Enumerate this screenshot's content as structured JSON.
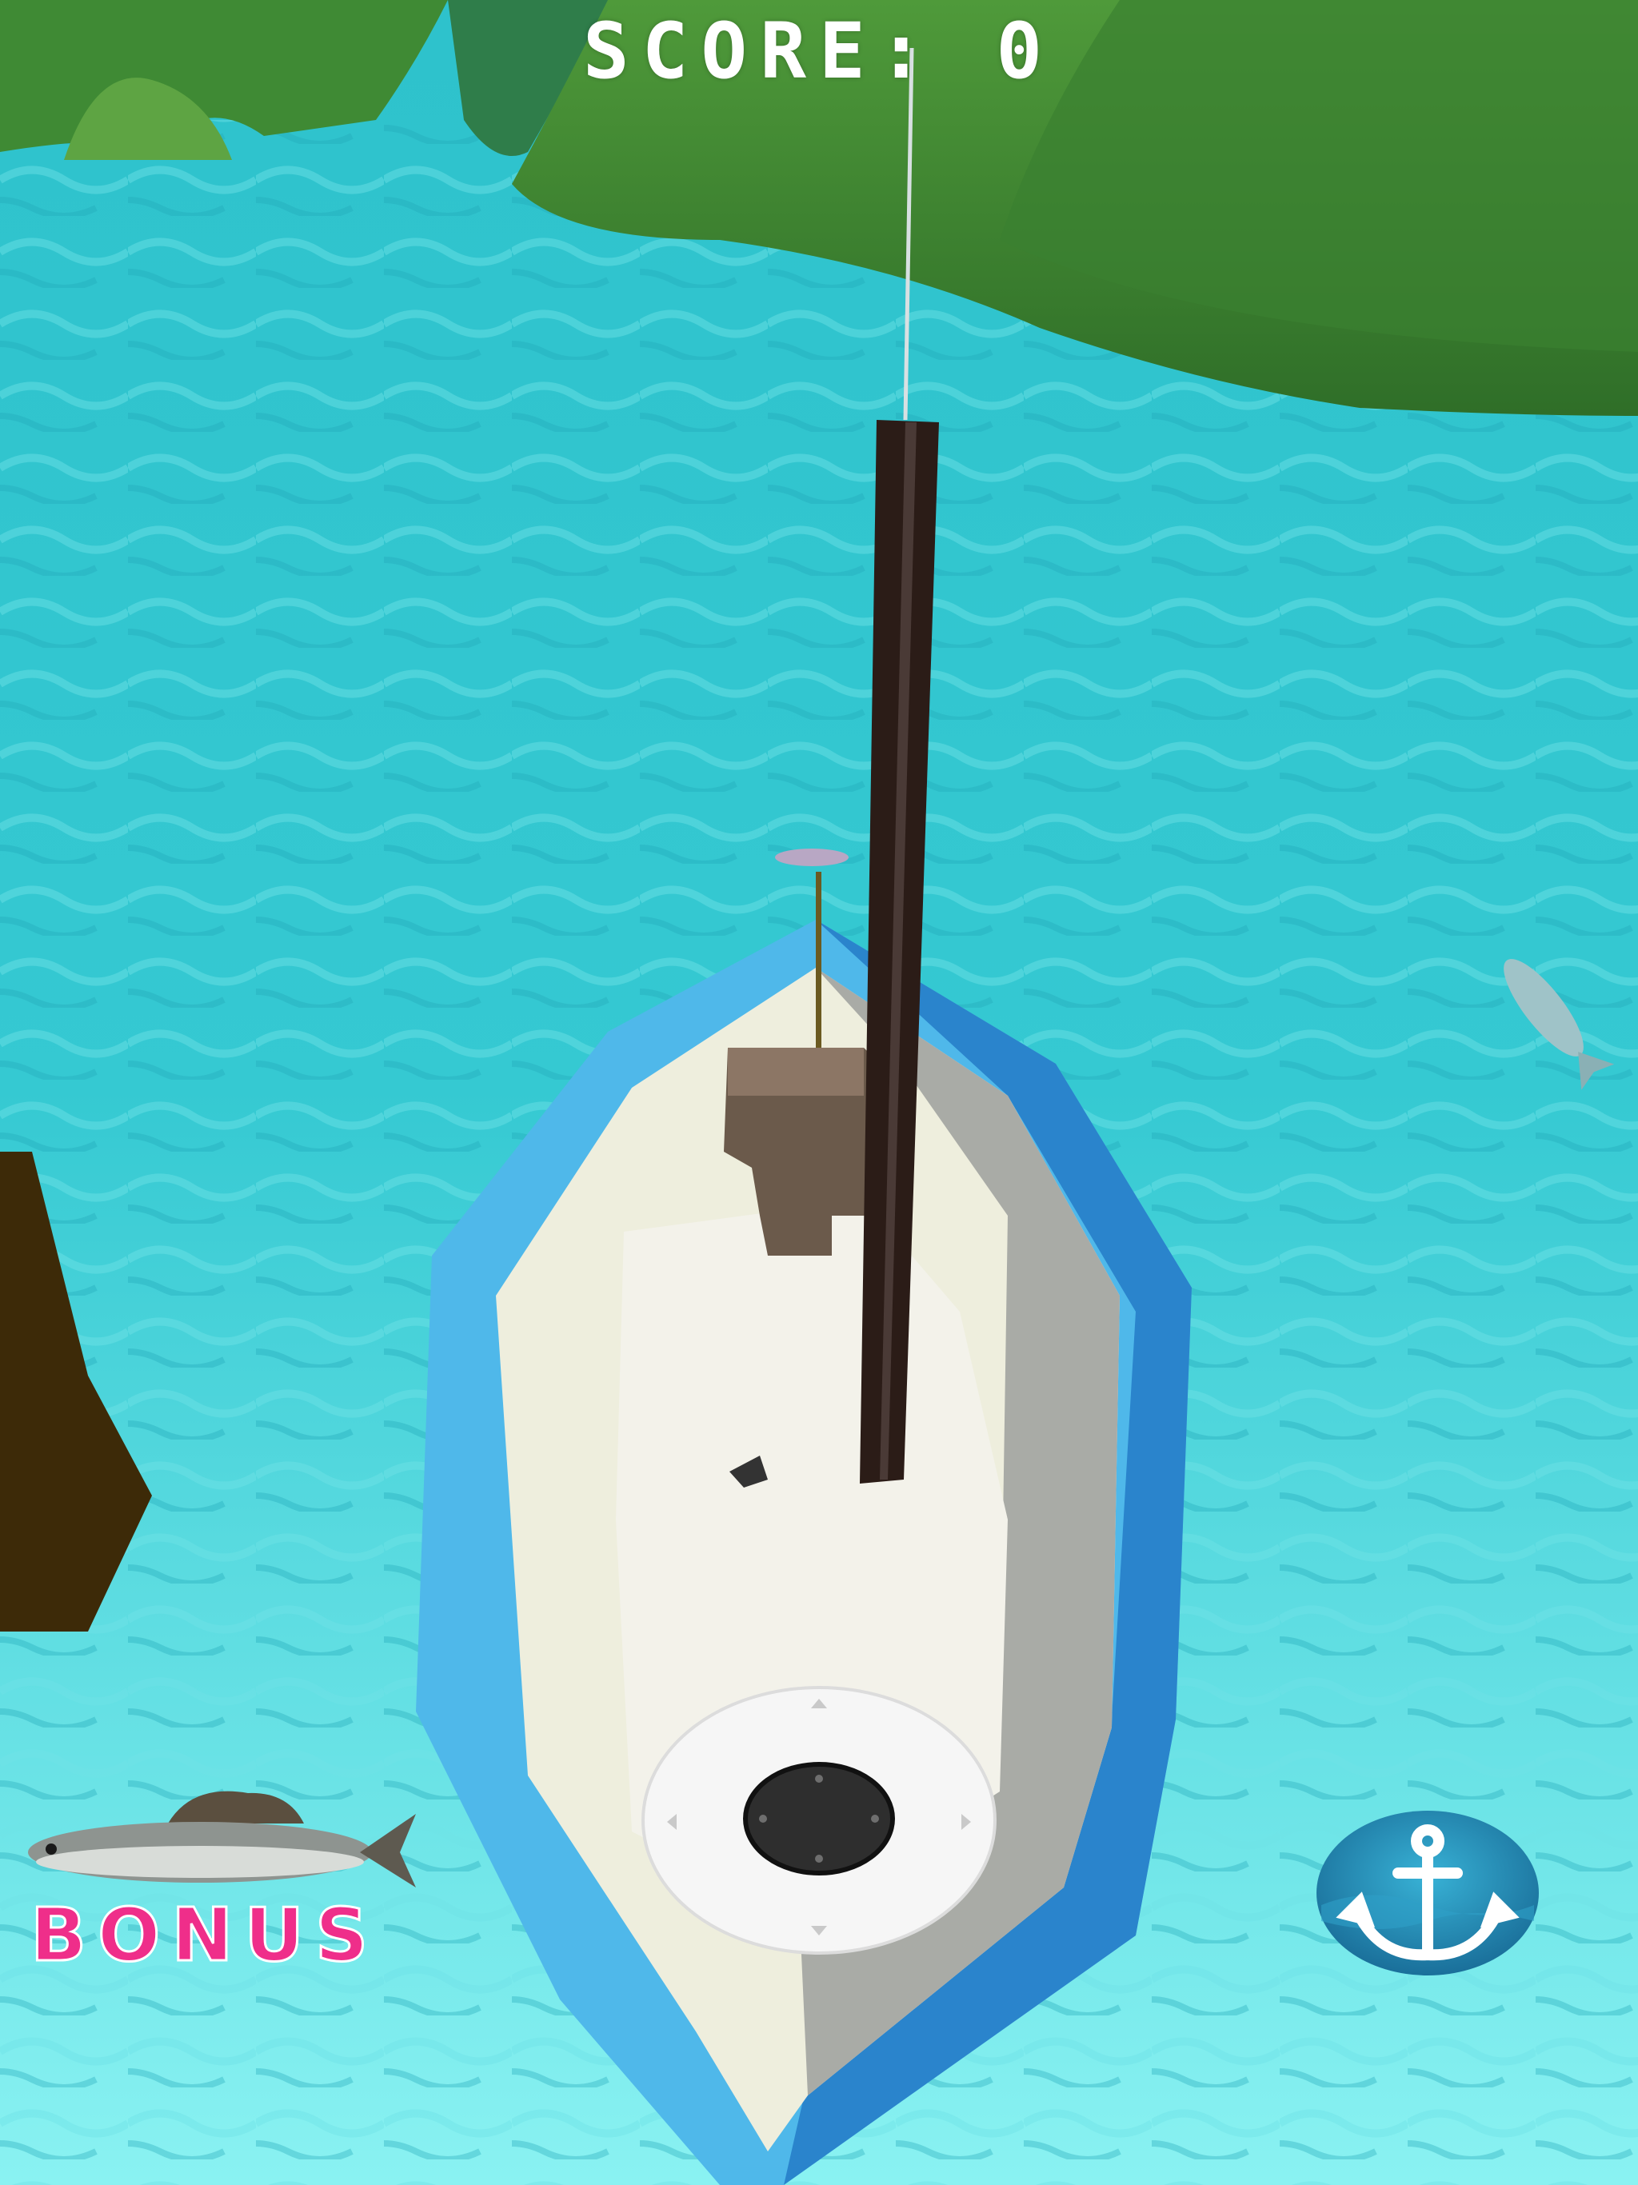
{
  "hud": {
    "score_label": "SCORE: 0",
    "score_value": 0
  },
  "controls": {
    "bonus_label": "BONUS",
    "anchor_icon": "anchor-icon",
    "joystick_icon": "dpad-joystick-icon"
  },
  "colors": {
    "water": "#3fcad3",
    "bonus_text": "#ef2e8a",
    "anchor_bg": "#1e8fb8",
    "boat_trim": "#4bb4e6"
  }
}
